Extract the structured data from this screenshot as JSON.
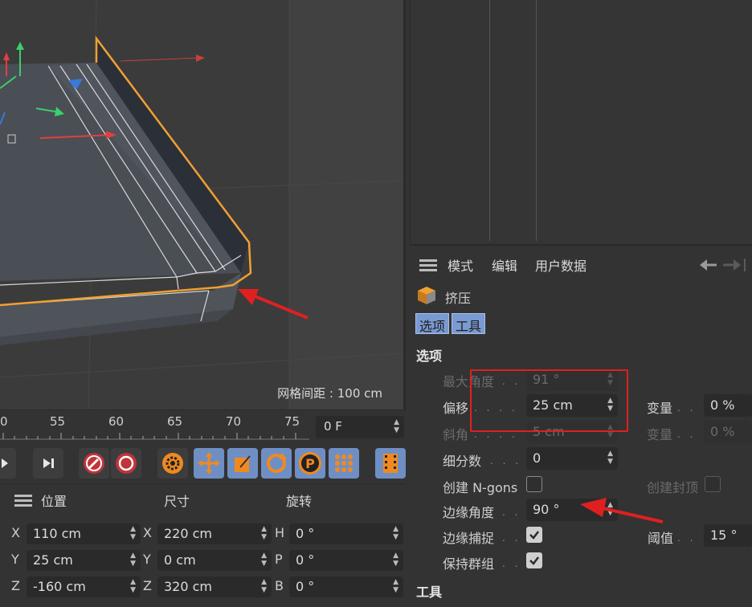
{
  "viewport": {
    "grid_label": "网格间距 : 100 cm"
  },
  "timeline": {
    "ticks": [
      "0",
      "55",
      "60",
      "65",
      "70",
      "75"
    ],
    "frame_value": "0 F"
  },
  "toolbar": {
    "buttons": [
      "play-to-end",
      "record-keys",
      "auto-key",
      "keyframe-settings",
      "move-key",
      "scale-key",
      "rotate-key",
      "param-key",
      "pla-key",
      "timeline-film"
    ]
  },
  "coords": {
    "headers": {
      "position": "位置",
      "size": "尺寸",
      "rotation": "旋转"
    },
    "rows": [
      {
        "axis": "X",
        "pos": "110 cm",
        "size_axis": "X",
        "size": "220 cm",
        "rot_axis": "H",
        "rot": "0 °"
      },
      {
        "axis": "Y",
        "pos": "25 cm",
        "size_axis": "Y",
        "size": "0 cm",
        "rot_axis": "P",
        "rot": "0 °"
      },
      {
        "axis": "Z",
        "pos": "-160 cm",
        "size_axis": "Z",
        "size": "320 cm",
        "rot_axis": "B",
        "rot": "0 °"
      }
    ]
  },
  "attributes": {
    "menu": {
      "mode": "模式",
      "edit": "编辑",
      "userdata": "用户数据"
    },
    "object_name": "挤压",
    "tabs": {
      "options": "选项",
      "tools": "工具"
    },
    "section_options": "选项",
    "section_tools": "工具",
    "fields": {
      "max_angle_label": "最大角度",
      "max_angle_value": "91 °",
      "offset_label": "偏移",
      "offset_value": "25 cm",
      "variation1_label": "变量",
      "variation1_value": "0 %",
      "bevel_label": "斜角",
      "bevel_value": "5 cm",
      "variation2_label": "变量",
      "variation2_value": "0 %",
      "subdivision_label": "细分数",
      "subdivision_value": "0",
      "create_ngons_label": "创建 N-gons",
      "create_cap_label": "创建封顶",
      "edge_angle_label": "边缘角度",
      "edge_angle_value": "90 °",
      "edge_snap_label": "边缘捕捉",
      "threshold_label": "阈值",
      "threshold_value": "15 °",
      "preserve_groups_label": "保持群组"
    }
  },
  "colors": {
    "selection_orange": "#f0a030",
    "annotation_red": "#e02020",
    "tab_blue": "#7a9ad2"
  }
}
